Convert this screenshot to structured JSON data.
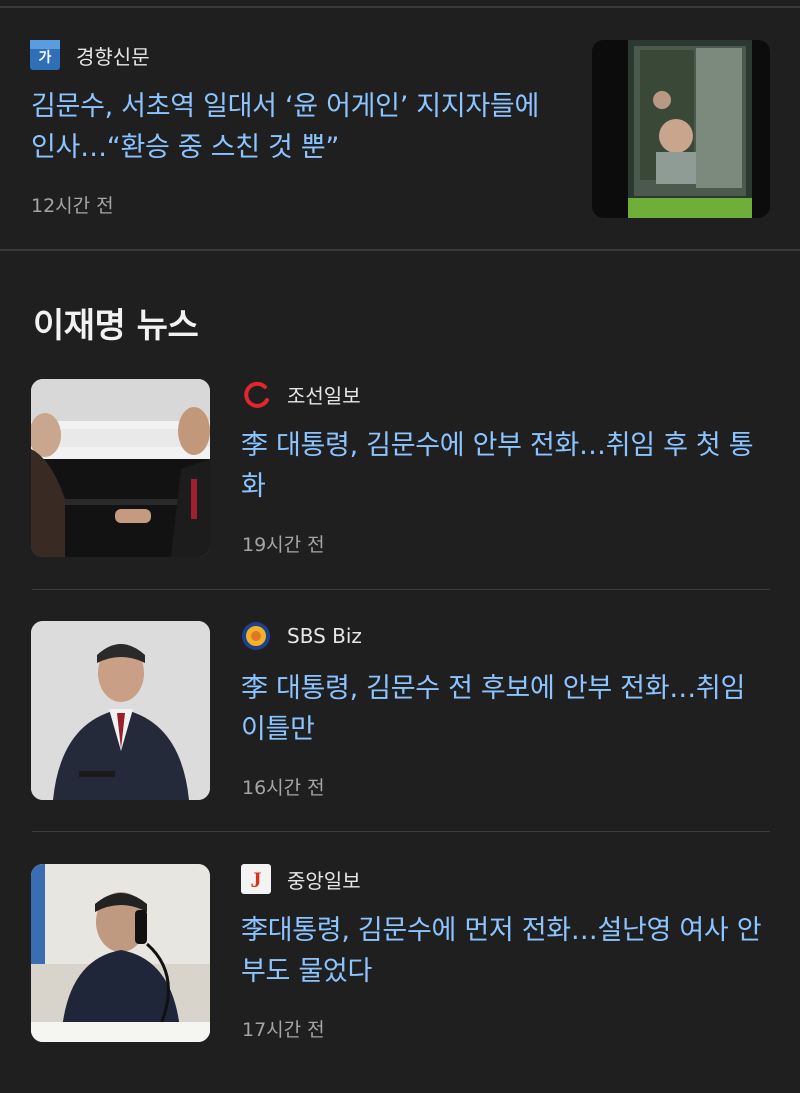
{
  "top_article": {
    "source": "경향신문",
    "title": "김문수, 서초역 일대서 ‘윤 어게인’ 지지자들에 인사…“환승 중 스친 것 뿐”",
    "time": "12시간 전",
    "thumbnail": "bus-window-man-photo"
  },
  "section": {
    "title": "이재명 뉴스"
  },
  "articles": [
    {
      "source": "조선일보",
      "title": "李 대통령, 김문수에 안부 전화…취임 후 첫 통화",
      "time": "19시간 전",
      "thumbnail": "handshake-photo"
    },
    {
      "source": "SBS Biz",
      "title": "李 대통령, 김문수 전 후보에 안부 전화…취임 이틀만",
      "time": "16시간 전",
      "thumbnail": "man-in-suit-photo"
    },
    {
      "source": "중앙일보",
      "title": "李대통령, 김문수에 먼저 전화…설난영 여사 안부도 물었다",
      "time": "17시간 전",
      "thumbnail": "phone-call-photo"
    }
  ],
  "colors": {
    "background": "#1f1f20",
    "headline": "#8cc4ff",
    "meta": "#a5a5a5"
  }
}
